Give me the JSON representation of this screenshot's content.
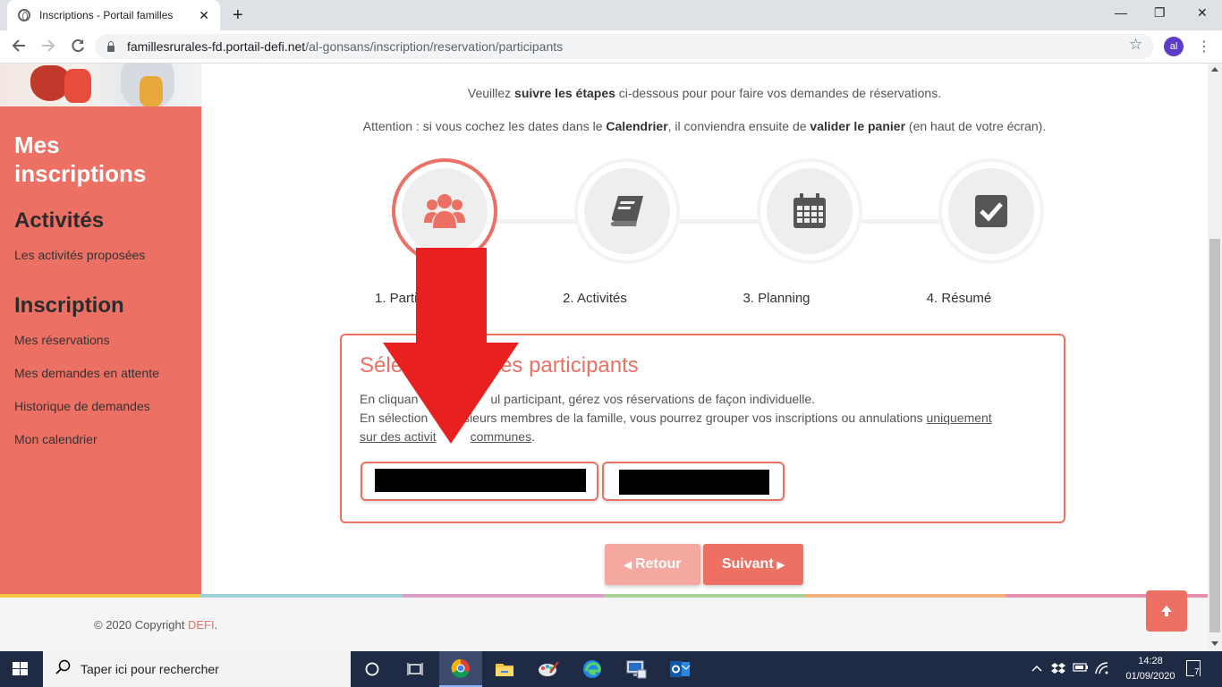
{
  "browser": {
    "tab_title": "Inscriptions - Portail familles",
    "tab_close": "✕",
    "new_tab": "+",
    "url_host": "famillesrurales-fd.portail-defi.net",
    "url_path": "/al-gonsans/inscription/reservation/participants",
    "profile_initials": "al",
    "minimize": "—",
    "maximize": "❐",
    "close": "✕"
  },
  "sidebar": {
    "title": "Mes inscriptions",
    "sections": [
      {
        "heading": "Activités",
        "links": [
          "Les activités proposées"
        ]
      },
      {
        "heading": "Inscription",
        "links": [
          "Mes réservations",
          "Mes demandes en attente",
          "Historique de demandes",
          "Mon calendrier"
        ]
      }
    ]
  },
  "main": {
    "intro1_pre": "Veuillez ",
    "intro1_bold": "suivre les étapes",
    "intro1_post": " ci-dessous pour pour faire vos demandes de réservations.",
    "intro2_pre": "Attention : si vous cochez les dates dans le ",
    "intro2_bold1": "Calendrier",
    "intro2_mid": ", il conviendra ensuite de ",
    "intro2_bold2": "valider le panier",
    "intro2_post": " (en haut de votre écran).",
    "steps": [
      {
        "label": "1. Partic",
        "icon": "users-icon"
      },
      {
        "label": "2. Activités",
        "icon": "book-icon"
      },
      {
        "label": "3. Planning",
        "icon": "calendar-icon"
      },
      {
        "label": "4. Résumé",
        "icon": "checkbox-icon"
      }
    ],
    "selection": {
      "title_left": "Séle",
      "title_right": "es participants",
      "line1_left": "En cliquan",
      "line1_right": "ul participant, gérez vos réservations de façon individuelle.",
      "line2_left": "En sélection",
      "line2_right": "usieurs membres de la famille, vous pourrez grouper vos inscriptions ou annulations ",
      "line2_link": "uniquement",
      "line3_link_left": "sur des activit",
      "line3_link_right": "communes",
      "line3_end": "."
    },
    "back_button": "Retour",
    "next_button": "Suivant"
  },
  "footer": {
    "copyright_prefix": "© 2020 Copyright ",
    "copyright_brand": "DEFI",
    "copyright_suffix": "."
  },
  "taskbar": {
    "search_placeholder": "Taper ici pour rechercher",
    "time": "14:28",
    "date": "01/09/2020",
    "notifications": "7"
  },
  "colors": {
    "accent": "#ec7063",
    "arrow": "#e8201f",
    "taskbar": "#1f2a44"
  }
}
